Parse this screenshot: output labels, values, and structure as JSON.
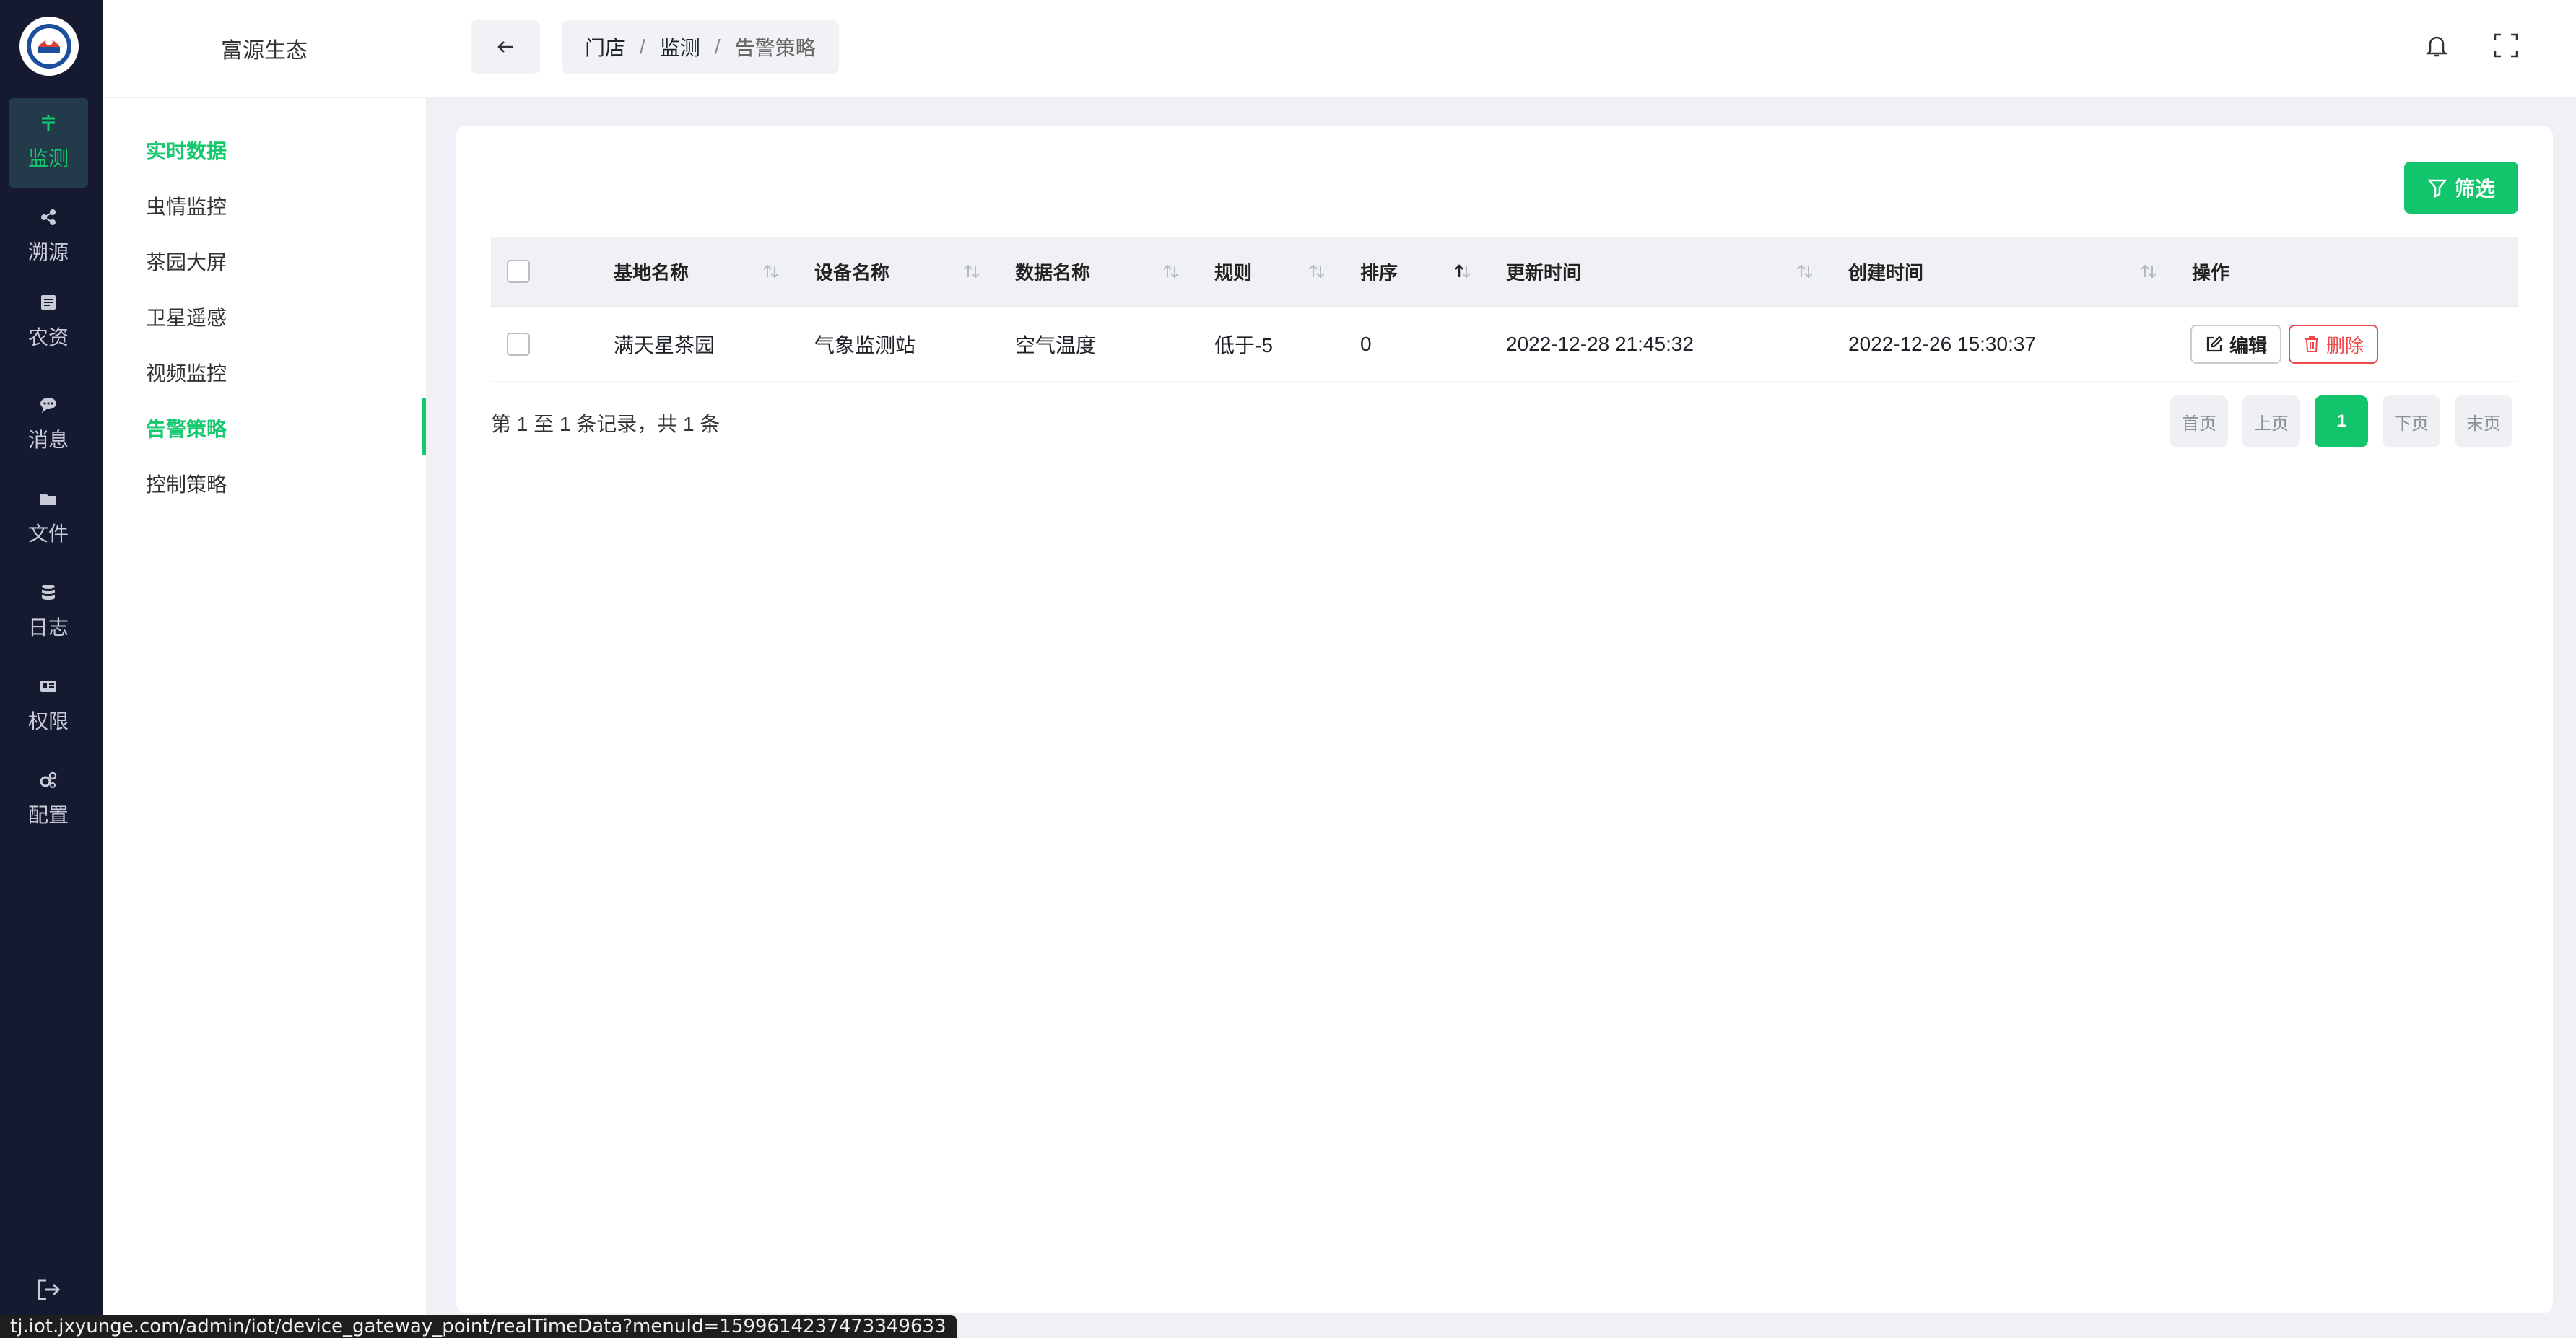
{
  "rail": {
    "items": [
      {
        "label": "监测",
        "icon": "monitor-icon",
        "active": true
      },
      {
        "label": "溯源",
        "icon": "share-icon"
      },
      {
        "label": "农资",
        "icon": "list-box-icon"
      },
      {
        "label": "消息",
        "icon": "chat-icon"
      },
      {
        "label": "文件",
        "icon": "folder-icon"
      },
      {
        "label": "日志",
        "icon": "database-icon"
      },
      {
        "label": "权限",
        "icon": "id-card-icon"
      },
      {
        "label": "配置",
        "icon": "gears-icon"
      }
    ]
  },
  "submenu": {
    "title": "富源生态",
    "items": [
      {
        "label": "实时数据",
        "active": true
      },
      {
        "label": "虫情监控"
      },
      {
        "label": "茶园大屏"
      },
      {
        "label": "卫星遥感"
      },
      {
        "label": "视频监控"
      },
      {
        "label": "告警策略",
        "active": true
      },
      {
        "label": "控制策略"
      }
    ]
  },
  "breadcrumb": [
    "门店",
    "监测",
    "告警策略"
  ],
  "toolbar": {
    "filter_label": "筛选"
  },
  "table": {
    "headers": [
      "基地名称",
      "设备名称",
      "数据名称",
      "规则",
      "排序",
      "更新时间",
      "创建时间",
      "操作"
    ],
    "rows": [
      {
        "base": "满天星茶园",
        "device": "气象监测站",
        "data_name": "空气温度",
        "rule": "低于-5",
        "order": "0",
        "updated": "2022-12-28 21:45:32",
        "created": "2022-12-26 15:30:37",
        "edit_label": "编辑",
        "delete_label": "删除"
      }
    ]
  },
  "summary": "第 1 至 1 条记录，共 1 条",
  "pagination": {
    "first": "首页",
    "prev": "上页",
    "current": "1",
    "next": "下页",
    "last": "末页"
  },
  "statusbar": "tj.iot.jxyunge.com/admin/iot/device_gateway_point/realTimeData?menuId=1599614237473349633",
  "colors": {
    "accent": "#12c56d",
    "rail_bg": "#151a30",
    "danger": "#f04848"
  }
}
